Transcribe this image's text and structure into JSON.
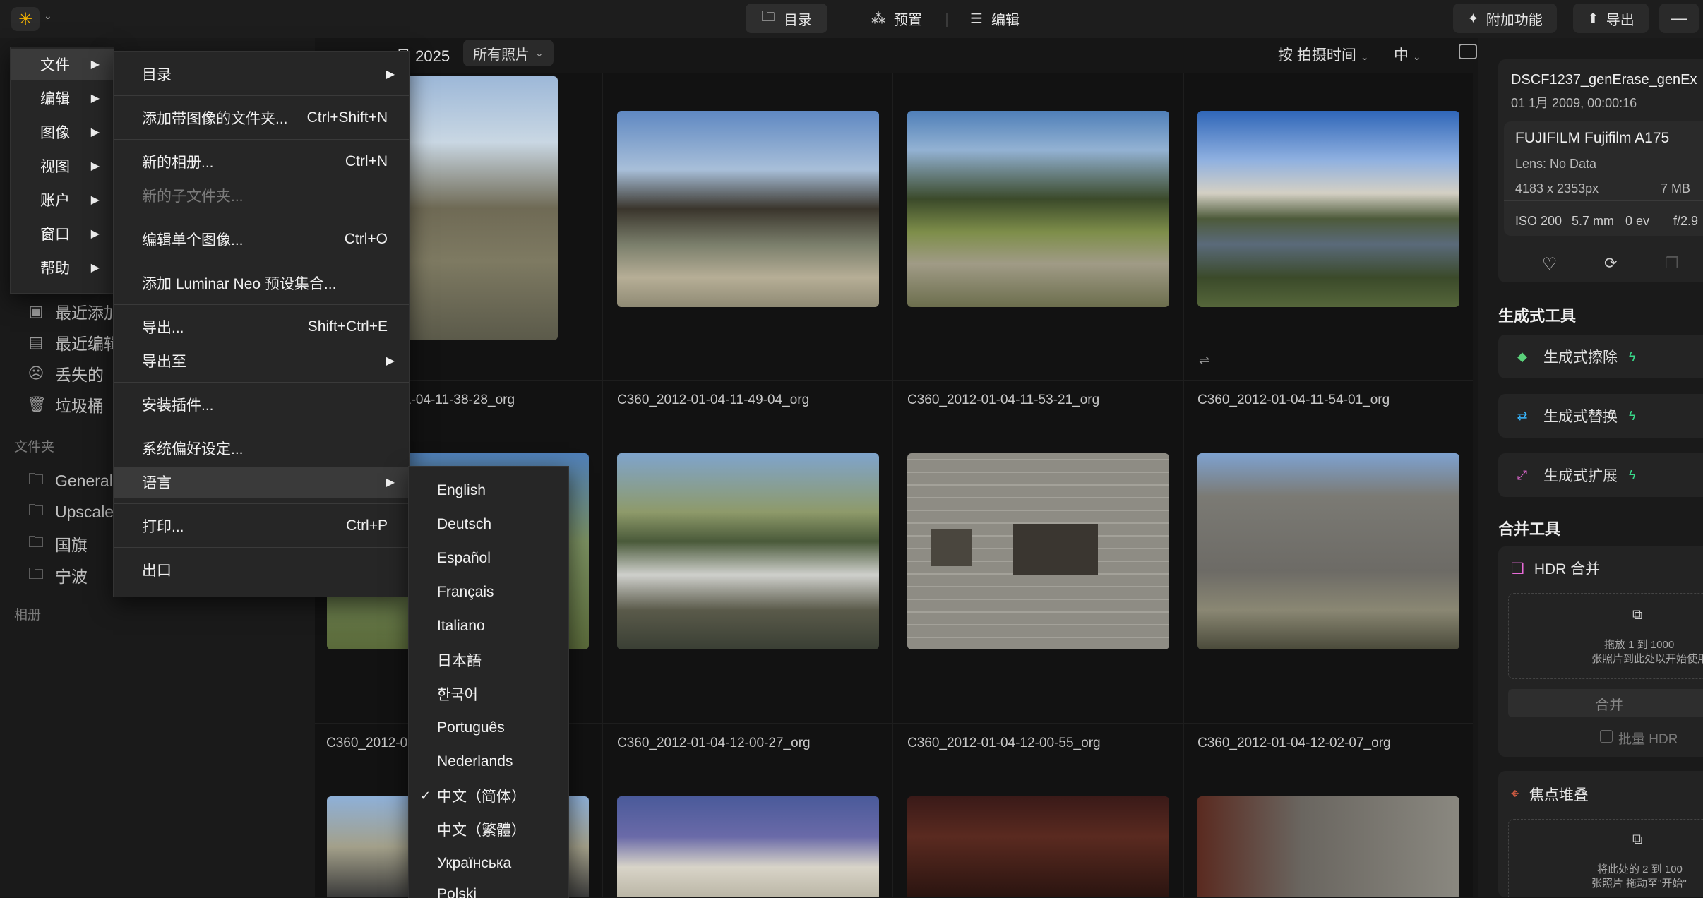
{
  "topbar": {
    "catalog": "目录",
    "presets": "预置",
    "edit": "编辑",
    "extras": "附加功能",
    "export": "导出"
  },
  "main_menu": [
    "文件",
    "编辑",
    "图像",
    "视图",
    "账户",
    "窗口",
    "帮助"
  ],
  "file_menu": {
    "catalog": "目录",
    "add_folder": "添加带图像的文件夹...",
    "add_folder_sc": "Ctrl+Shift+N",
    "new_album": "新的相册...",
    "new_album_sc": "Ctrl+N",
    "new_subfolder": "新的子文件夹...",
    "edit_single": "编辑单个图像...",
    "edit_single_sc": "Ctrl+O",
    "add_preset": "添加 Luminar Neo 预设集合...",
    "export": "导出...",
    "export_sc": "Shift+Ctrl+E",
    "export_to": "导出至",
    "install_plugin": "安装插件...",
    "prefs": "系统偏好设定...",
    "language": "语言",
    "print": "打印...",
    "print_sc": "Ctrl+P",
    "exit": "出口"
  },
  "languages": [
    "English",
    "Deutsch",
    "Español",
    "Français",
    "Italiano",
    "日本語",
    "한국어",
    "Português",
    "Nederlands",
    "中文（简体）",
    "中文（繁體）",
    "Українська",
    "Polski"
  ],
  "checkmark": "✓",
  "sidebar": {
    "recent_added": "最近添加",
    "recent_edited": "最近编辑",
    "lost": "丢失的",
    "trash": "垃圾桶",
    "folders_label": "文件夹",
    "folders": [
      "General",
      "Upscale",
      "国旗",
      "宁波"
    ],
    "albums_label": "相册"
  },
  "header": {
    "date_tail": "月 2025",
    "date_partial": "1月 2025",
    "filter": "所有照片",
    "sort": "按 拍摄时间",
    "size": "中"
  },
  "files": {
    "r1": [
      "1-04-11-38-28_org",
      "C360_2012-01-04-11-49-04_org",
      "C360_2012-01-04-11-53-21_org",
      "C360_2012-01-04-11-54-01_org"
    ],
    "r2": [
      "C360_2012-01",
      "C360_2012-01-04-12-00-27_org",
      "C360_2012-01-04-12-00-55_org",
      "C360_2012-01-04-12-02-07_org"
    ]
  },
  "info": {
    "filename": "DSCF1237_genErase_genEx",
    "datetime": "01 1月 2009, 00:00:16",
    "camera": "FUJIFILM Fujifilm A175",
    "lens": "Lens: No Data",
    "dims": "4183 x 2353px",
    "size": "7 MB",
    "iso": "ISO 200",
    "focal": "5.7 mm",
    "ev": "0 ev",
    "aperture": "f/2.9"
  },
  "gen_tools": {
    "title": "生成式工具",
    "erase": "生成式擦除",
    "swap": "生成式替换",
    "expand": "生成式扩展"
  },
  "merge_tools": {
    "title": "合并工具",
    "hdr": "HDR 合并",
    "hdr_drop1": "拖放 1 到 1000",
    "hdr_drop2": "张照片到此处以开始使用",
    "merge_btn": "合并",
    "batch_hdr": "批量 HDR",
    "focus": "焦点堆叠",
    "focus_drop1": "将此处的 2 到 100",
    "focus_drop2": "张照片 拖动至\"开始\""
  },
  "colors": {
    "accent": "#f5b400",
    "bolt": "#39d98a"
  }
}
